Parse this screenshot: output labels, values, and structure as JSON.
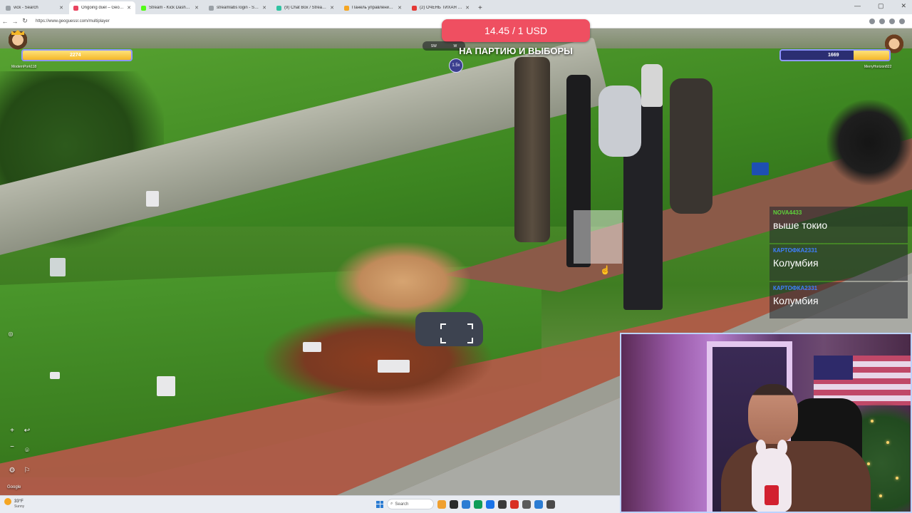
{
  "browser": {
    "tabs": [
      {
        "title": "vick - Search",
        "color": "#9aa0a6",
        "active": false
      },
      {
        "title": "Ongoing duel – GeoGuessr",
        "color": "#e94560",
        "active": true
      },
      {
        "title": "Stream - Kick Dashboard",
        "color": "#53fc18",
        "active": false
      },
      {
        "title": "streamlabs login - Search",
        "color": "#9aa0a6",
        "active": false
      },
      {
        "title": "(9) Chat Box / Streamlabs",
        "color": "#31c3a2",
        "active": false
      },
      {
        "title": "Панель управления - DonationAl",
        "color": "#f5a623",
        "active": false
      },
      {
        "title": "(2) ОЧЕНЬ ТИХАЯ - ЮНОСТЬ В",
        "color": "#e53935",
        "active": false
      }
    ],
    "new_tab": "+",
    "window_controls": [
      "—",
      "▢",
      "✕"
    ],
    "nav": [
      "←",
      "→",
      "↻"
    ],
    "url": "https://www.geoguessr.com/multiplayer"
  },
  "game": {
    "donation": "14.45 / 1 USD",
    "donation_message": "НА ПАРТИЮ И ВЫБОРЫ",
    "multiplier": "1.5x",
    "minimap_labels": [
      "SW",
      "W"
    ],
    "left_player": {
      "name": "ModernPork118",
      "health": "2274",
      "health_fraction": 1.0
    },
    "right_player": {
      "name": "MerryHorizon822",
      "health": "1669",
      "health_fraction": 0.33
    },
    "controls": {
      "zoom_in": "+",
      "zoom_out": "−",
      "undo": "↩",
      "settings": "⚙"
    },
    "google_mark": "Google"
  },
  "chat": [
    {
      "user": "NOVA4433",
      "user_color": "#5ed13b",
      "text": "выше токио"
    },
    {
      "user": "КАРТОФКА2331",
      "user_color": "#3f7fff",
      "text": "Колумбия"
    },
    {
      "user": "КАРТОФКА2331",
      "user_color": "#3f7fff",
      "text": "Колумбия"
    }
  ],
  "taskbar": {
    "temperature": "33°F",
    "condition": "Sunny",
    "search_placeholder": "Search",
    "apps": [
      "#f0a030",
      "#2b2b2b",
      "#2b7cd3",
      "#0f9d58",
      "#1a73e8",
      "#3a3a3a",
      "#d93025",
      "#5a5a5a",
      "#2b7cd3",
      "#4a4a4a"
    ]
  }
}
